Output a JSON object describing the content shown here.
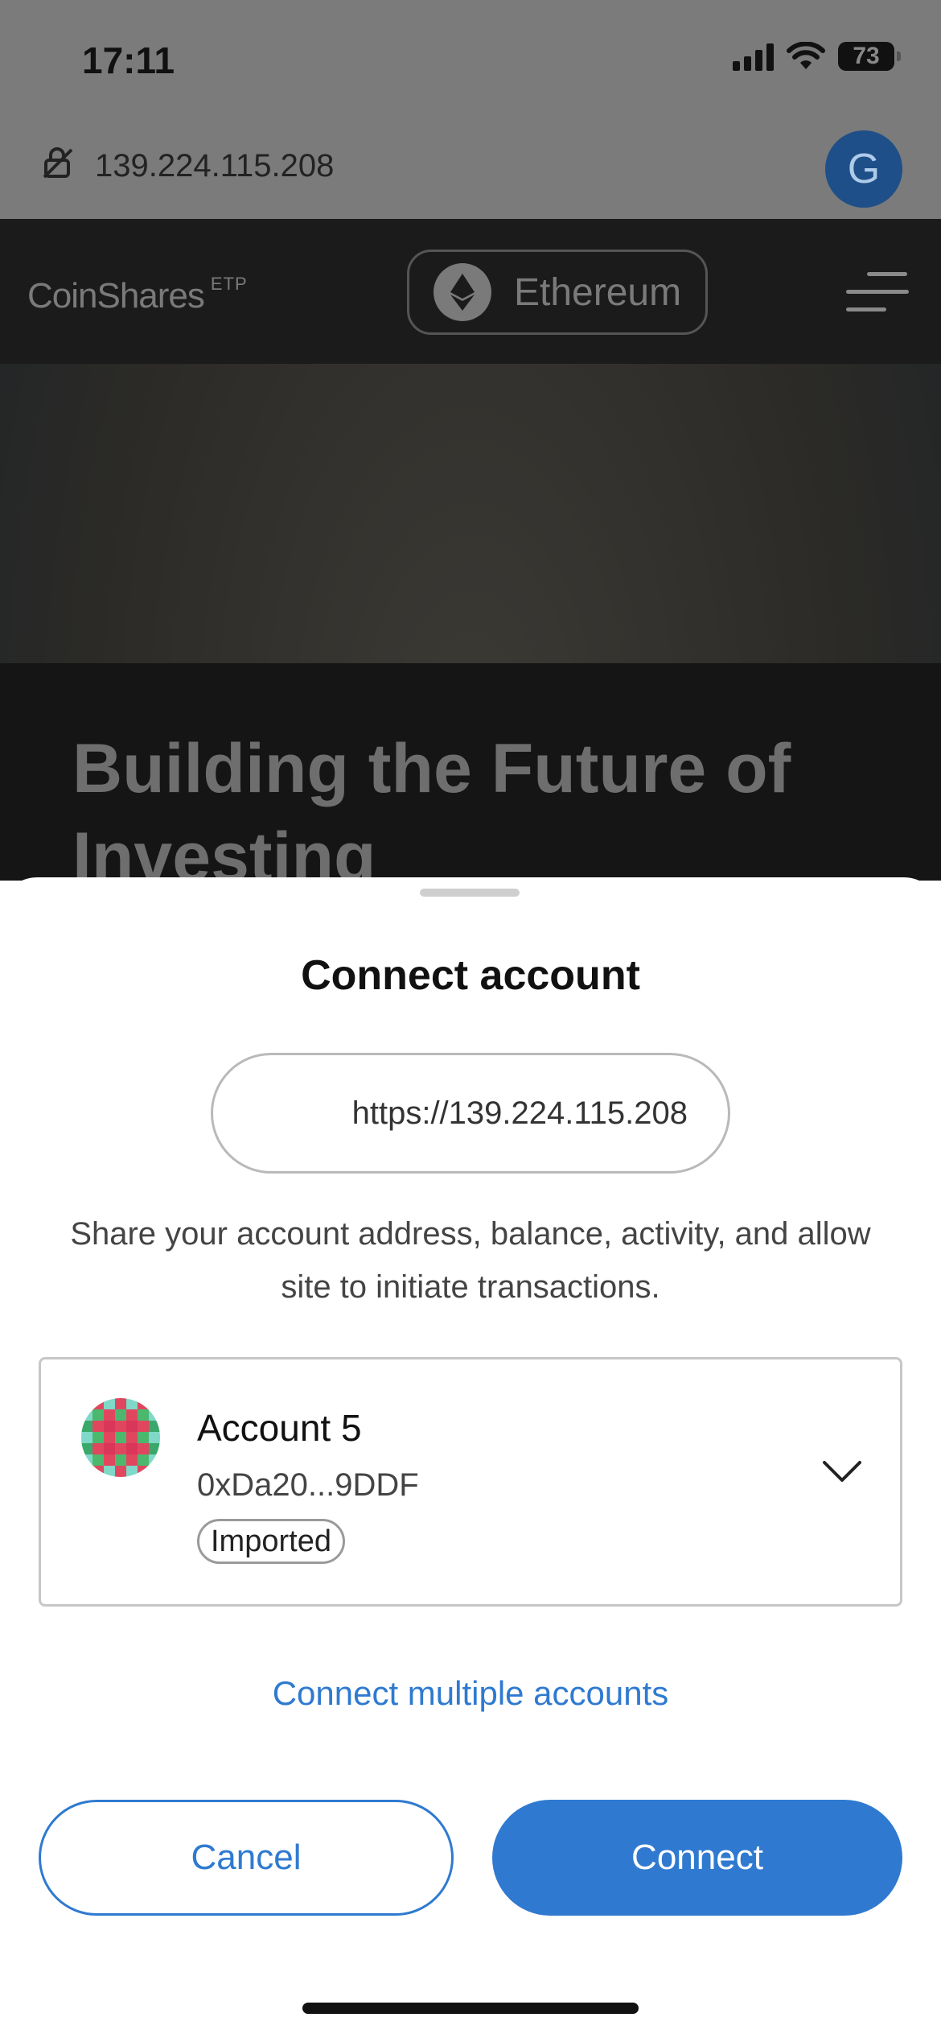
{
  "status_bar": {
    "time": "17:11",
    "battery": "73"
  },
  "browser": {
    "url": "139.224.115.208",
    "profile_initial": "G"
  },
  "site": {
    "brand": "CoinShares",
    "brand_suffix": "ETP",
    "network_label": "Ethereum",
    "hero_heading": "Building the Future of Investing"
  },
  "sheet": {
    "title": "Connect account",
    "origin": "https://139.224.115.208",
    "description": "Share your account address, balance, activity, and allow site to initiate transactions.",
    "account": {
      "name": "Account 5",
      "address": "0xDa20...9DDF",
      "badge": "Imported"
    },
    "multi_link": "Connect multiple accounts",
    "cancel_label": "Cancel",
    "connect_label": "Connect"
  },
  "colors": {
    "accent": "#2f7ad0",
    "identicon": [
      "#3aa86a",
      "#e0475f",
      "#7fd8c8",
      "#4bb86e",
      "#d9365a"
    ]
  }
}
